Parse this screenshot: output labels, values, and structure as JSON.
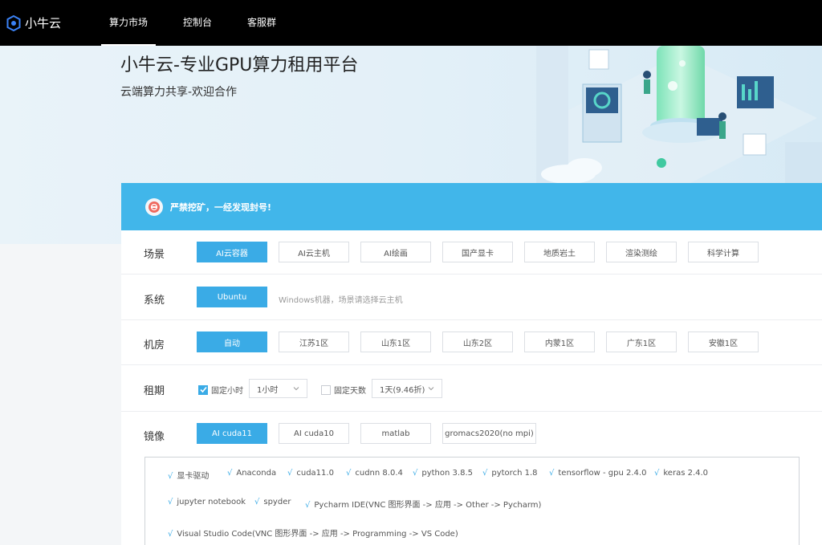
{
  "app": {
    "name": "小牛云"
  },
  "nav": {
    "items": [
      {
        "label": "算力市场",
        "active": true
      },
      {
        "label": "控制台"
      },
      {
        "label": "客服群"
      }
    ]
  },
  "hero": {
    "title": "小牛云-专业GPU算力租用平台",
    "subtitle": "云端算力共享-欢迎合作"
  },
  "notice": {
    "text": "严禁挖矿，一经发现封号!"
  },
  "scene": {
    "label": "场景",
    "options": [
      "AI云容器",
      "AI云主机",
      "AI绘画",
      "国产显卡",
      "地质岩土",
      "渲染测绘",
      "科学计算"
    ],
    "selected": 0
  },
  "system": {
    "label": "系统",
    "options": [
      "Ubuntu"
    ],
    "selected": 0,
    "hint": "Windows机器，场景请选择云主机"
  },
  "room": {
    "label": "机房",
    "options": [
      "自动",
      "江苏1区",
      "山东1区",
      "山东2区",
      "内蒙1区",
      "广东1区",
      "安徽1区"
    ],
    "selected": 0
  },
  "rent": {
    "label": "租期",
    "hourly": {
      "label": "固定小时",
      "checked": true,
      "value": "1小时"
    },
    "daily": {
      "label": "固定天数",
      "checked": false,
      "value": "1天(9.46折)"
    }
  },
  "image": {
    "label": "镜像",
    "options": [
      "AI cuda11",
      "AI cuda10",
      "matlab",
      "gromacs2020(no mpi)"
    ],
    "selected": 0
  },
  "software": {
    "row1": [
      "显卡驱动",
      "Anaconda",
      "cuda11.0",
      "cudnn 8.0.4",
      "python 3.8.5",
      "pytorch 1.8",
      "tensorflow - gpu 2.4.0",
      "keras 2.4.0"
    ],
    "row2": [
      "jupyter notebook",
      "spyder",
      "Pycharm IDE(VNC 图形界面 -> 应用 -> Other -> Pycharm)"
    ],
    "row3": [
      "Visual Studio Code(VNC 图形界面 -> 应用 -> Programming -> VS Code)"
    ]
  },
  "colors": {
    "accent": "#3aabe6",
    "notice_bg": "#41b6ea",
    "topbar": "#000000"
  },
  "icons": {
    "logo": "cloud-logo-icon",
    "notice": "warning-icon",
    "check": "check-icon",
    "dropdown": "chevron-down-icon"
  }
}
